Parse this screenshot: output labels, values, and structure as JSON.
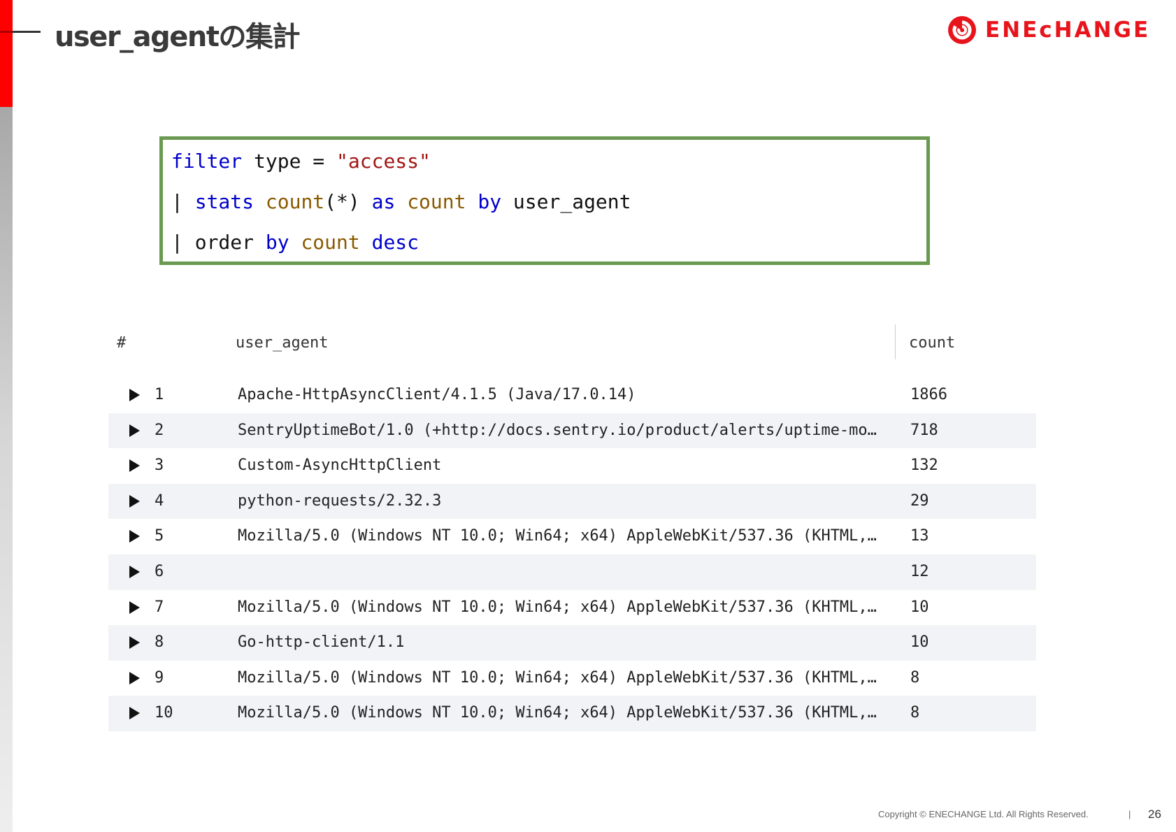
{
  "slide": {
    "title": "user_agentの集計",
    "logo_text": "ENEⅽHANGE",
    "footer": "Copyright © ENECHANGE Ltd.  All Rights Reserved.",
    "footer_sep": "|",
    "page_number": "26",
    "accent_color": "#ff0000",
    "brand_color": "#e8141c"
  },
  "query": {
    "line1": [
      {
        "t": "filter",
        "k": "kw"
      },
      {
        "t": " type = ",
        "k": "plain"
      },
      {
        "t": "\"access\"",
        "k": "str"
      }
    ],
    "line2": [
      {
        "t": "| ",
        "k": "plain"
      },
      {
        "t": "stats",
        "k": "kw"
      },
      {
        "t": " ",
        "k": "plain"
      },
      {
        "t": "count",
        "k": "fn"
      },
      {
        "t": "(*) ",
        "k": "plain"
      },
      {
        "t": "as",
        "k": "kw"
      },
      {
        "t": " ",
        "k": "plain"
      },
      {
        "t": "count",
        "k": "fn"
      },
      {
        "t": " ",
        "k": "plain"
      },
      {
        "t": "by",
        "k": "kw"
      },
      {
        "t": " user_agent",
        "k": "plain"
      }
    ],
    "line3": [
      {
        "t": "| order ",
        "k": "plain"
      },
      {
        "t": "by",
        "k": "kw"
      },
      {
        "t": " ",
        "k": "plain"
      },
      {
        "t": "count",
        "k": "fn"
      },
      {
        "t": " ",
        "k": "plain"
      },
      {
        "t": "desc",
        "k": "kw"
      }
    ],
    "border_color": "#6a9a52"
  },
  "table": {
    "headers": {
      "hash": "#",
      "user_agent": "user_agent",
      "count": "count"
    },
    "rows": [
      {
        "idx": "1",
        "ua": "Apache-HttpAsyncClient/4.1.5 (Java/17.0.14)",
        "count": "1866"
      },
      {
        "idx": "2",
        "ua": "SentryUptimeBot/1.0 (+http://docs.sentry.io/product/alerts/uptime-mo…",
        "count": "718"
      },
      {
        "idx": "3",
        "ua": "Custom-AsyncHttpClient",
        "count": "132"
      },
      {
        "idx": "4",
        "ua": "python-requests/2.32.3",
        "count": "29"
      },
      {
        "idx": "5",
        "ua": "Mozilla/5.0 (Windows NT 10.0; Win64; x64) AppleWebKit/537.36 (KHTML,…",
        "count": "13"
      },
      {
        "idx": "6",
        "ua": "",
        "count": "12"
      },
      {
        "idx": "7",
        "ua": "Mozilla/5.0 (Windows NT 10.0; Win64; x64) AppleWebKit/537.36 (KHTML,…",
        "count": "10"
      },
      {
        "idx": "8",
        "ua": "Go-http-client/1.1",
        "count": "10"
      },
      {
        "idx": "9",
        "ua": "Mozilla/5.0 (Windows NT 10.0; Win64; x64) AppleWebKit/537.36 (KHTML,…",
        "count": "8"
      },
      {
        "idx": "10",
        "ua": "Mozilla/5.0 (Windows NT 10.0; Win64; x64) AppleWebKit/537.36 (KHTML,…",
        "count": "8"
      }
    ]
  }
}
